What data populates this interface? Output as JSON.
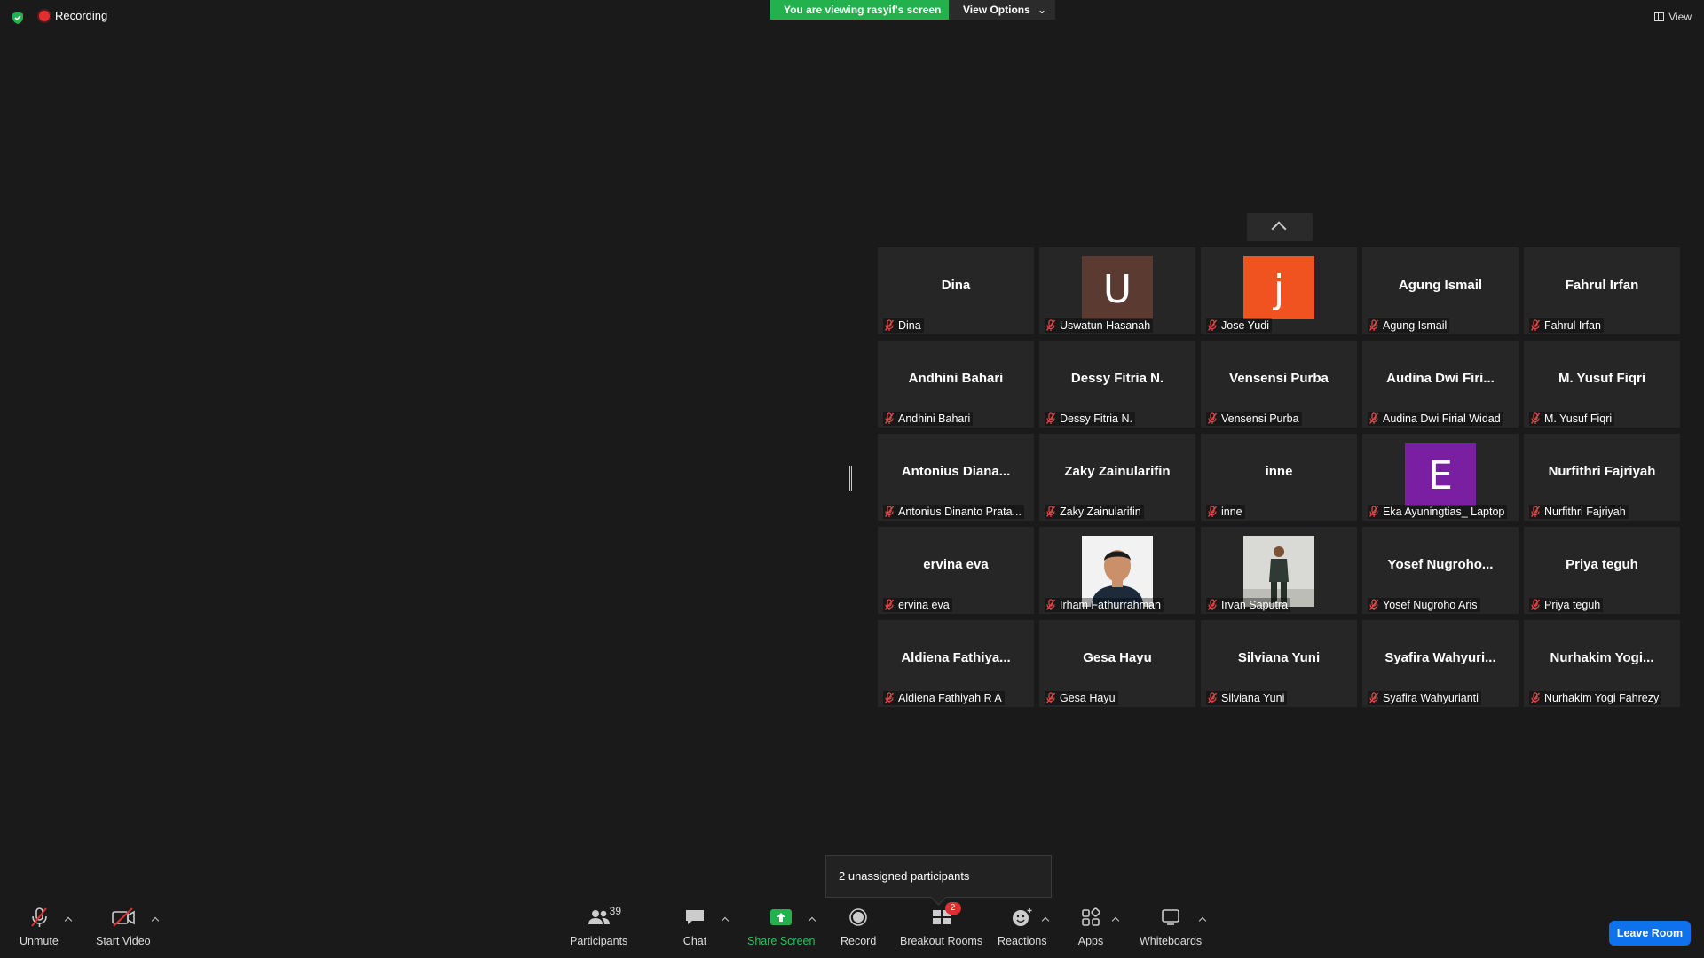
{
  "top": {
    "recording_label": "Recording",
    "viewing_banner": "You are viewing rasyif's screen",
    "view_options_label": "View Options",
    "view_label": "View"
  },
  "tiles": [
    {
      "big": "Dina",
      "label": "Dina"
    },
    {
      "avatar": "U",
      "avatar_color": "#5b3a31",
      "label": "Uswatun Hasanah"
    },
    {
      "avatar": "j",
      "avatar_color": "#f0531f",
      "label": "Jose Yudi"
    },
    {
      "big": "Agung Ismail",
      "label": "Agung Ismail"
    },
    {
      "big": "Fahrul Irfan",
      "label": "Fahrul Irfan"
    },
    {
      "big": "Andhini Bahari",
      "label": "Andhini Bahari"
    },
    {
      "big": "Dessy Fitria N.",
      "label": "Dessy Fitria N."
    },
    {
      "big": "Vensensi Purba",
      "label": "Vensensi Purba"
    },
    {
      "big": "Audina Dwi Firi...",
      "label": "Audina Dwi Firial Widad"
    },
    {
      "big": "M. Yusuf Fiqri",
      "label": "M. Yusuf Fiqri"
    },
    {
      "big": "Antonius Diana...",
      "label": "Antonius Dinanto Prata..."
    },
    {
      "big": "Zaky Zainularifin",
      "label": "Zaky Zainularifin"
    },
    {
      "big": "inne",
      "label": "inne"
    },
    {
      "avatar": "E",
      "avatar_color": "#7b1fa2",
      "label": "Eka Ayuningtias_ Laptop"
    },
    {
      "big": "Nurfithri Fajriyah",
      "label": "Nurfithri Fajriyah"
    },
    {
      "big": "ervina eva",
      "label": "ervina eva"
    },
    {
      "photo": "portrait-photo",
      "label": "Irham Fathurrahman"
    },
    {
      "photo": "standing-photo",
      "label": "Irvan Saputra"
    },
    {
      "big": "Yosef Nugroho...",
      "label": "Yosef Nugroho Aris"
    },
    {
      "big": "Priya teguh",
      "label": "Priya teguh"
    },
    {
      "big": "Aldiena Fathiya...",
      "label": "Aldiena Fathiyah R A"
    },
    {
      "big": "Gesa Hayu",
      "label": "Gesa Hayu"
    },
    {
      "big": "Silviana Yuni",
      "label": "Silviana Yuni"
    },
    {
      "big": "Syafira Wahyuri...",
      "label": "Syafira Wahyurianti"
    },
    {
      "big": "Nurhakim Yogi...",
      "label": "Nurhakim Yogi Fahrezy"
    }
  ],
  "tooltip": "2 unassigned participants",
  "toolbar": {
    "unmute": "Unmute",
    "start_video": "Start Video",
    "participants": "Participants",
    "participants_count": "39",
    "chat": "Chat",
    "share_screen": "Share Screen",
    "record": "Record",
    "breakout_rooms": "Breakout Rooms",
    "breakout_badge": "2",
    "reactions": "Reactions",
    "apps": "Apps",
    "whiteboards": "Whiteboards",
    "leave_room": "Leave Room"
  },
  "colors": {
    "share_green": "#22b14c",
    "leave_blue": "#0e72ed",
    "mute_red": "#e02f2f"
  }
}
